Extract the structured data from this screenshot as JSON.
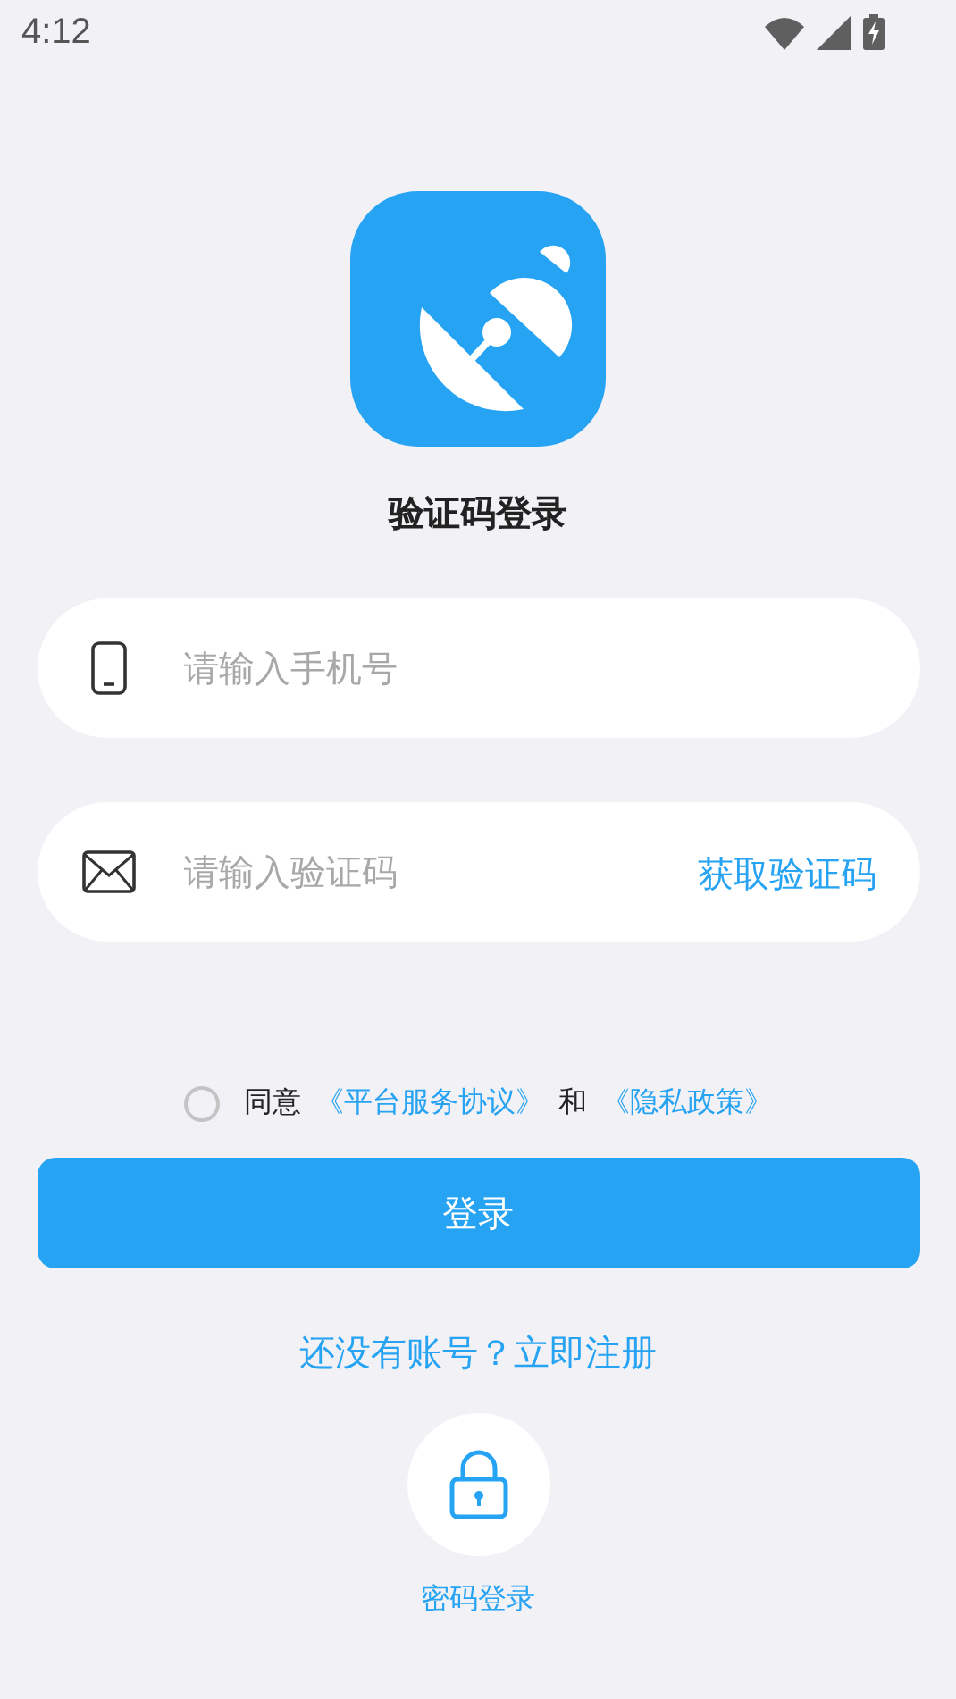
{
  "status_bar": {
    "time": "4:12"
  },
  "title": "验证码登录",
  "fields": [
    {
      "kind": "phone",
      "placeholder": "请输入手机号"
    },
    {
      "kind": "code",
      "placeholder": "请输入验证码",
      "action": "获取验证码"
    }
  ],
  "agreement": {
    "checked": false,
    "parts": [
      {
        "kind": "text",
        "text": "同意"
      },
      {
        "kind": "link",
        "text": "《平台服务协议》"
      },
      {
        "kind": "text",
        "text": "和"
      },
      {
        "kind": "link",
        "text": "《隐私政策》"
      }
    ]
  },
  "login_button": "登录",
  "register_link": "还没有账号？立即注册",
  "password_login": {
    "label": "密码登录"
  }
}
